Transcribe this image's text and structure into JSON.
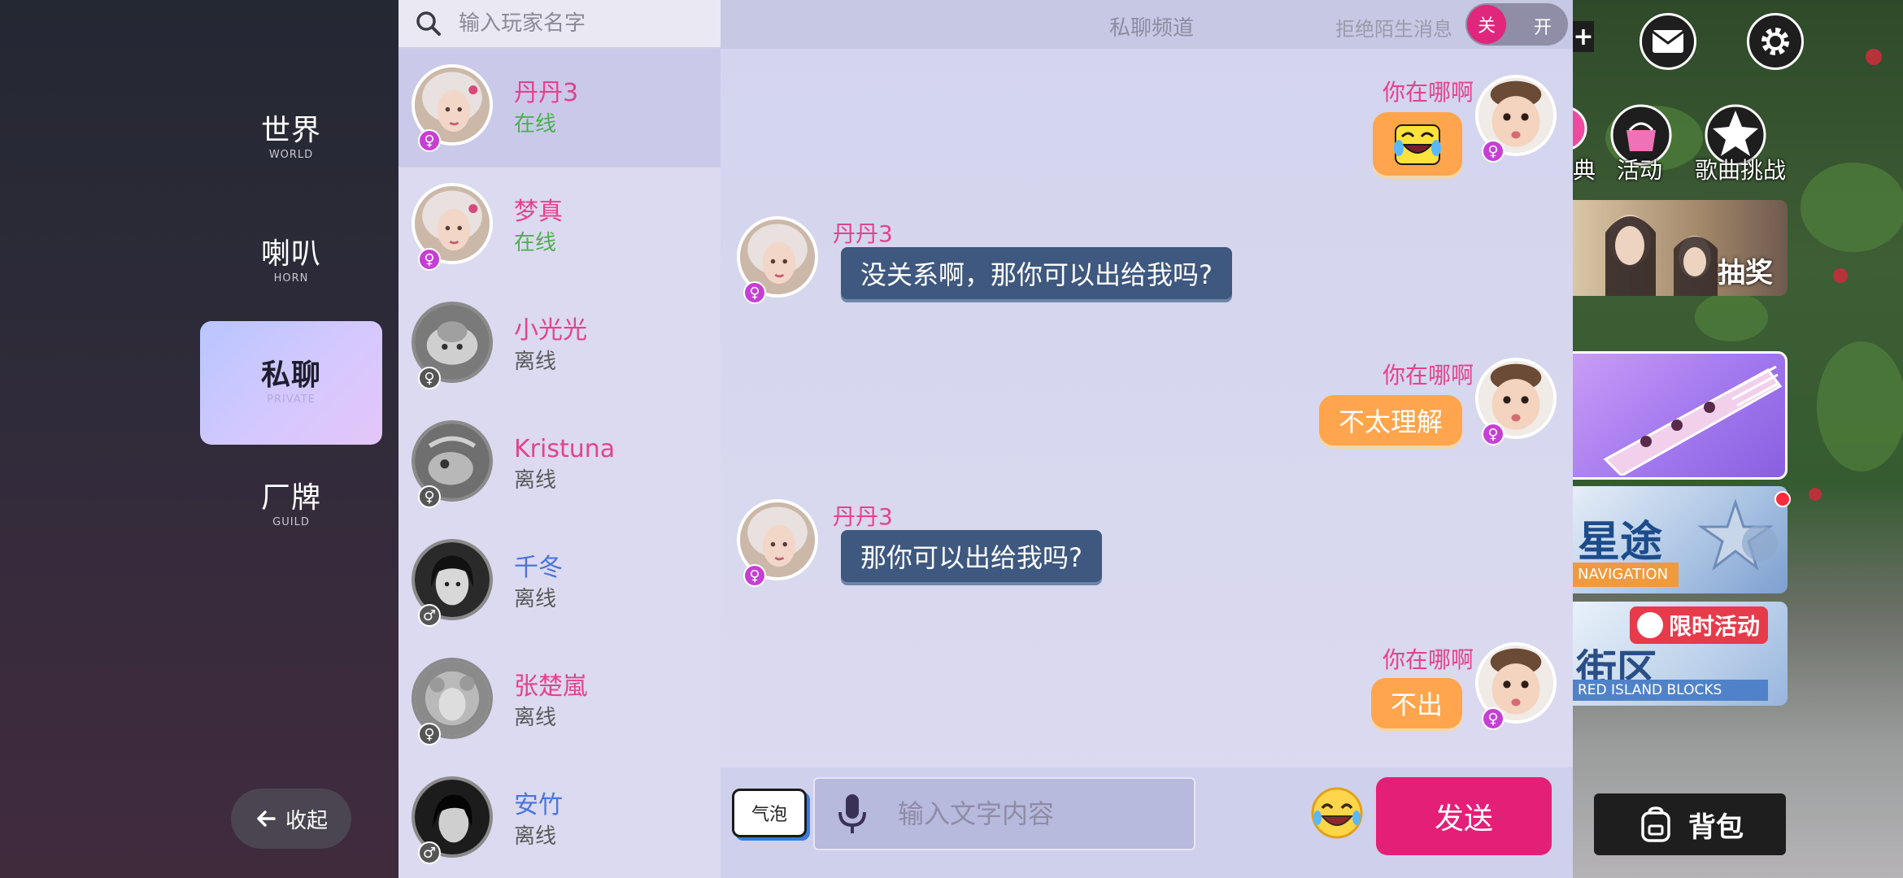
{
  "sidebar": {
    "categories": [
      {
        "zh": "世界",
        "en": "WORLD"
      },
      {
        "zh": "喇叭",
        "en": "HORN"
      },
      {
        "zh": "私聊",
        "en": "PRIVATE"
      },
      {
        "zh": "厂牌",
        "en": "GUILD"
      }
    ],
    "active_index": 2,
    "collapse_label": "收起"
  },
  "contacts": {
    "search_placeholder": "输入玩家名字",
    "items": [
      {
        "name": "丹丹3",
        "status": "在线",
        "gender": "female",
        "online": true,
        "name_color": "pink"
      },
      {
        "name": "梦真",
        "status": "在线",
        "gender": "female",
        "online": true,
        "name_color": "pink"
      },
      {
        "name": "小光光",
        "status": "离线",
        "gender": "female",
        "online": false,
        "name_color": "pink"
      },
      {
        "name": "Kristuna",
        "status": "离线",
        "gender": "female",
        "online": false,
        "name_color": "pink"
      },
      {
        "name": "千冬",
        "status": "离线",
        "gender": "male",
        "online": false,
        "name_color": "blue"
      },
      {
        "name": "张楚嵐",
        "status": "离线",
        "gender": "female",
        "online": false,
        "name_color": "pink"
      },
      {
        "name": "安竹",
        "status": "离线",
        "gender": "male",
        "online": false,
        "name_color": "blue"
      }
    ]
  },
  "chat": {
    "title": "私聊频道",
    "reject_label": "拒绝陌生消息",
    "toggle_off": "关",
    "toggle_on": "开",
    "messages": [
      {
        "side": "right",
        "sender": "你在哪啊",
        "text": "",
        "emoji": "laughing-emoji"
      },
      {
        "side": "left",
        "sender": "丹丹3",
        "text": "没关系啊，那你可以出给我吗?"
      },
      {
        "side": "right",
        "sender": "你在哪啊",
        "text": "不太理解"
      },
      {
        "side": "left",
        "sender": "丹丹3",
        "text": "那你可以出给我吗?"
      },
      {
        "side": "right",
        "sender": "你在哪啊",
        "text": "不出"
      }
    ],
    "input": {
      "bubble_label": "气泡",
      "placeholder": "输入文字内容",
      "send_label": "发送"
    }
  },
  "game": {
    "menu": [
      "典",
      "活动",
      "歌曲挑战"
    ],
    "lottery_label": "抽奖",
    "star_title": "星途",
    "star_subtitle": "NAVIGATION",
    "street_title": "街区",
    "street_subtitle": "RED ISLAND BLOCKS",
    "limited_label": "限时活动",
    "backpack_label": "背包"
  },
  "colors": {
    "accent_pink": "#e41f78",
    "bubble_orange": "#ffa54d",
    "bubble_blue": "#3e587f",
    "online_green": "#4caf50"
  }
}
